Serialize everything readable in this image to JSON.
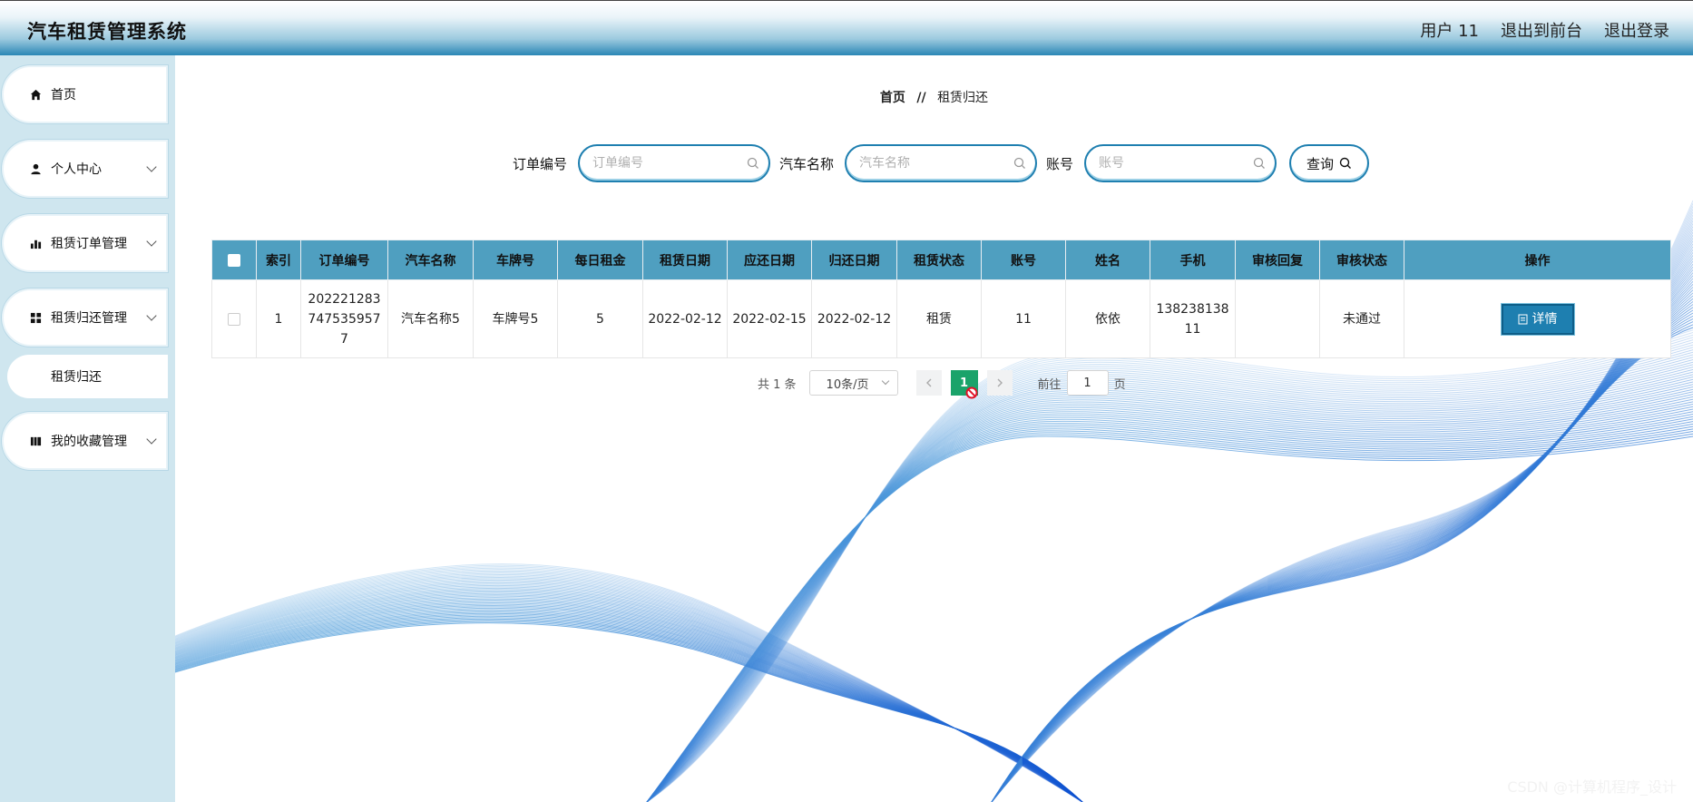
{
  "header": {
    "title": "汽车租赁管理系统",
    "user": "用户 11",
    "to_front": "退出到前台",
    "logout": "退出登录"
  },
  "sidebar": {
    "items": [
      {
        "label": "首页",
        "icon": "home-icon"
      },
      {
        "label": "个人中心",
        "icon": "user-icon"
      },
      {
        "label": "租赁订单管理",
        "icon": "bar-chart-icon"
      },
      {
        "label": "租赁归还管理",
        "icon": "grid-icon"
      },
      {
        "label": "我的收藏管理",
        "icon": "book-icon"
      }
    ],
    "sub_item": "租赁归还"
  },
  "breadcrumb": {
    "home": "首页",
    "separator": "//",
    "current": "租赁归还"
  },
  "search": {
    "order_label": "订单编号",
    "order_placeholder": "订单编号",
    "car_label": "汽车名称",
    "car_placeholder": "汽车名称",
    "account_label": "账号",
    "account_placeholder": "账号",
    "query_label": "查询"
  },
  "table": {
    "headers": [
      "索引",
      "订单编号",
      "汽车名称",
      "车牌号",
      "每日租金",
      "租赁日期",
      "应还日期",
      "归还日期",
      "租赁状态",
      "账号",
      "姓名",
      "手机",
      "审核回复",
      "审核状态",
      "操作"
    ],
    "rows": [
      {
        "index": "1",
        "order_no": "2022212837475359577",
        "car_name": "汽车名称5",
        "plate": "车牌号5",
        "daily_rent": "5",
        "rent_date": "2022-02-12",
        "due_date": "2022-02-15",
        "return_date": "2022-02-12",
        "status": "租赁",
        "account": "11",
        "name": "依依",
        "phone": "13823813811",
        "reply": "",
        "audit": "未通过",
        "action": "详情"
      }
    ]
  },
  "pagination": {
    "total": "共 1 条",
    "page_size": "10条/页",
    "current": "1",
    "goto_label": "前往",
    "goto_value": "1",
    "page_unit": "页"
  },
  "watermark": "CSDN @计算机程序_设计",
  "colors": {
    "accent": "#1e7fb0",
    "header_bg": "#4f9fc0",
    "sidebar_bg": "#cfe6ef",
    "page_active": "#1aa36a"
  }
}
